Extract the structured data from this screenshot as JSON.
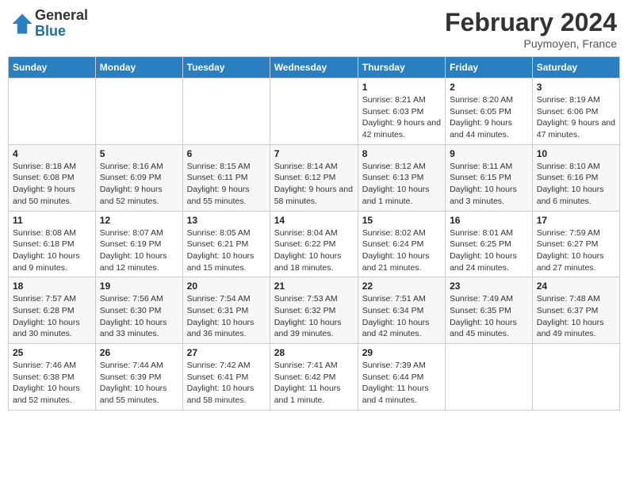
{
  "header": {
    "logo_general": "General",
    "logo_blue": "Blue",
    "title": "February 2024",
    "subtitle": "Puymoyen, France"
  },
  "days_of_week": [
    "Sunday",
    "Monday",
    "Tuesday",
    "Wednesday",
    "Thursday",
    "Friday",
    "Saturday"
  ],
  "weeks": [
    [
      {
        "day": "",
        "info": ""
      },
      {
        "day": "",
        "info": ""
      },
      {
        "day": "",
        "info": ""
      },
      {
        "day": "",
        "info": ""
      },
      {
        "day": "1",
        "info": "Sunrise: 8:21 AM\nSunset: 6:03 PM\nDaylight: 9 hours and 42 minutes."
      },
      {
        "day": "2",
        "info": "Sunrise: 8:20 AM\nSunset: 6:05 PM\nDaylight: 9 hours and 44 minutes."
      },
      {
        "day": "3",
        "info": "Sunrise: 8:19 AM\nSunset: 6:06 PM\nDaylight: 9 hours and 47 minutes."
      }
    ],
    [
      {
        "day": "4",
        "info": "Sunrise: 8:18 AM\nSunset: 6:08 PM\nDaylight: 9 hours and 50 minutes."
      },
      {
        "day": "5",
        "info": "Sunrise: 8:16 AM\nSunset: 6:09 PM\nDaylight: 9 hours and 52 minutes."
      },
      {
        "day": "6",
        "info": "Sunrise: 8:15 AM\nSunset: 6:11 PM\nDaylight: 9 hours and 55 minutes."
      },
      {
        "day": "7",
        "info": "Sunrise: 8:14 AM\nSunset: 6:12 PM\nDaylight: 9 hours and 58 minutes."
      },
      {
        "day": "8",
        "info": "Sunrise: 8:12 AM\nSunset: 6:13 PM\nDaylight: 10 hours and 1 minute."
      },
      {
        "day": "9",
        "info": "Sunrise: 8:11 AM\nSunset: 6:15 PM\nDaylight: 10 hours and 3 minutes."
      },
      {
        "day": "10",
        "info": "Sunrise: 8:10 AM\nSunset: 6:16 PM\nDaylight: 10 hours and 6 minutes."
      }
    ],
    [
      {
        "day": "11",
        "info": "Sunrise: 8:08 AM\nSunset: 6:18 PM\nDaylight: 10 hours and 9 minutes."
      },
      {
        "day": "12",
        "info": "Sunrise: 8:07 AM\nSunset: 6:19 PM\nDaylight: 10 hours and 12 minutes."
      },
      {
        "day": "13",
        "info": "Sunrise: 8:05 AM\nSunset: 6:21 PM\nDaylight: 10 hours and 15 minutes."
      },
      {
        "day": "14",
        "info": "Sunrise: 8:04 AM\nSunset: 6:22 PM\nDaylight: 10 hours and 18 minutes."
      },
      {
        "day": "15",
        "info": "Sunrise: 8:02 AM\nSunset: 6:24 PM\nDaylight: 10 hours and 21 minutes."
      },
      {
        "day": "16",
        "info": "Sunrise: 8:01 AM\nSunset: 6:25 PM\nDaylight: 10 hours and 24 minutes."
      },
      {
        "day": "17",
        "info": "Sunrise: 7:59 AM\nSunset: 6:27 PM\nDaylight: 10 hours and 27 minutes."
      }
    ],
    [
      {
        "day": "18",
        "info": "Sunrise: 7:57 AM\nSunset: 6:28 PM\nDaylight: 10 hours and 30 minutes."
      },
      {
        "day": "19",
        "info": "Sunrise: 7:56 AM\nSunset: 6:30 PM\nDaylight: 10 hours and 33 minutes."
      },
      {
        "day": "20",
        "info": "Sunrise: 7:54 AM\nSunset: 6:31 PM\nDaylight: 10 hours and 36 minutes."
      },
      {
        "day": "21",
        "info": "Sunrise: 7:53 AM\nSunset: 6:32 PM\nDaylight: 10 hours and 39 minutes."
      },
      {
        "day": "22",
        "info": "Sunrise: 7:51 AM\nSunset: 6:34 PM\nDaylight: 10 hours and 42 minutes."
      },
      {
        "day": "23",
        "info": "Sunrise: 7:49 AM\nSunset: 6:35 PM\nDaylight: 10 hours and 45 minutes."
      },
      {
        "day": "24",
        "info": "Sunrise: 7:48 AM\nSunset: 6:37 PM\nDaylight: 10 hours and 49 minutes."
      }
    ],
    [
      {
        "day": "25",
        "info": "Sunrise: 7:46 AM\nSunset: 6:38 PM\nDaylight: 10 hours and 52 minutes."
      },
      {
        "day": "26",
        "info": "Sunrise: 7:44 AM\nSunset: 6:39 PM\nDaylight: 10 hours and 55 minutes."
      },
      {
        "day": "27",
        "info": "Sunrise: 7:42 AM\nSunset: 6:41 PM\nDaylight: 10 hours and 58 minutes."
      },
      {
        "day": "28",
        "info": "Sunrise: 7:41 AM\nSunset: 6:42 PM\nDaylight: 11 hours and 1 minute."
      },
      {
        "day": "29",
        "info": "Sunrise: 7:39 AM\nSunset: 6:44 PM\nDaylight: 11 hours and 4 minutes."
      },
      {
        "day": "",
        "info": ""
      },
      {
        "day": "",
        "info": ""
      }
    ]
  ]
}
